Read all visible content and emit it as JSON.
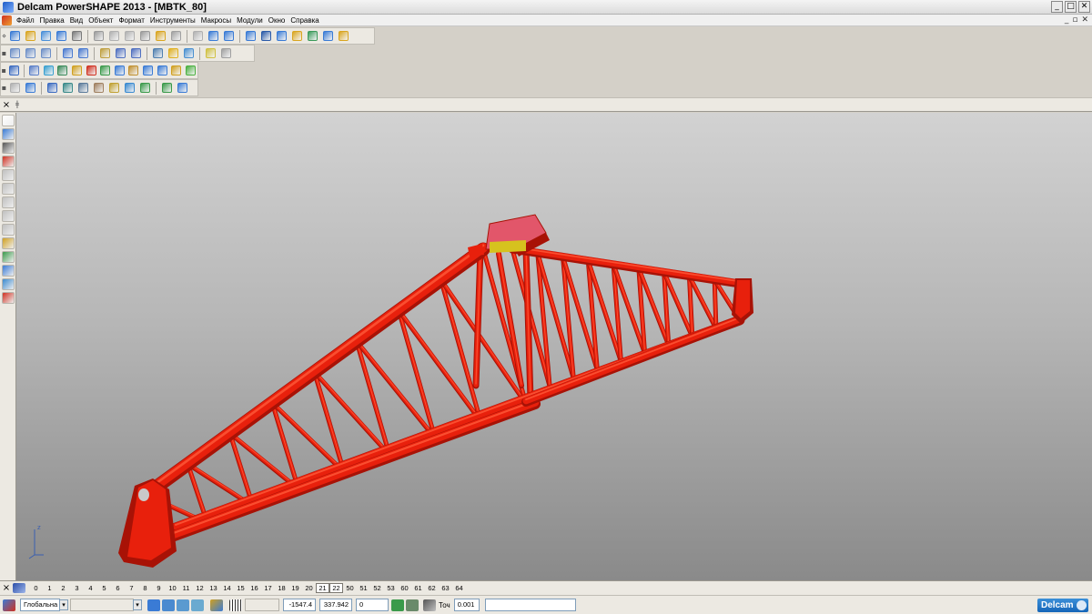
{
  "window": {
    "title": "Delcam PowerSHAPE 2013 - [MBTK_80]",
    "min": "_",
    "max": "□",
    "close": "✕"
  },
  "menu": {
    "items": [
      "Файл",
      "Правка",
      "Вид",
      "Объект",
      "Формат",
      "Инструменты",
      "Макросы",
      "Модули",
      "Окно",
      "Справка"
    ],
    "mdi_min": "_",
    "mdi_restore": "▫",
    "mdi_close": "✕"
  },
  "toolbars": {
    "row1_colors": [
      "#3a7bd5",
      "#d9a520",
      "#4a90d9",
      "#3a7bd5",
      "#7a7a7a",
      "#9a9a9a",
      "#b0b0b0",
      "#b0b0b0",
      "#9a9a9a",
      "#d9a520",
      "#a0a0a0",
      "#b0b0b0",
      "#3a7bd5",
      "#3a7bd5",
      "#3a7bd5",
      "#2a5aa8",
      "#3a7bd5",
      "#d9a520",
      "#3a9a5a",
      "#3a7bd5",
      "#d9a520"
    ],
    "row2_colors": [
      "#6d8fc7",
      "#6d8fc7",
      "#6d8fc7",
      "#4a7ad0",
      "#4a7ad0",
      "#c0a040",
      "#5070c0",
      "#5070c0",
      "#5080b0",
      "#e0b020",
      "#4a90d0",
      "#d0c040",
      "#a0a0a0"
    ],
    "row3_colors": [
      "#3a6ac0",
      "#5a7fc8",
      "#3aa0d0",
      "#3a8a5a",
      "#d0a020",
      "#d03020",
      "#3a9a4a",
      "#3a7bd5",
      "#c09030",
      "#3a7bd5",
      "#3a7bd5",
      "#d0a020",
      "#4ab040"
    ],
    "row4_colors": [
      "#b0b0b0",
      "#3a7bd5",
      "#3a6ac0",
      "#3a8a8a",
      "#5a7a9a",
      "#a08060",
      "#c0a030",
      "#3a8ad0",
      "#3a9a4a",
      "#3a9a4a",
      "#3a7bd5"
    ]
  },
  "lefttool_colors": [
    "#ffffff",
    "#3a7bd5",
    "#555555",
    "#d03020",
    "#c0c0c0",
    "#c0c0c0",
    "#c0c0c0",
    "#c0c0c0",
    "#c0c0c0",
    "#d0a020",
    "#3a9a4a",
    "#3a7bd5",
    "#3a8ad0",
    "#d03020"
  ],
  "levels": {
    "items": [
      "0",
      "1",
      "2",
      "3",
      "4",
      "5",
      "6",
      "7",
      "8",
      "9",
      "10",
      "11",
      "12",
      "13",
      "14",
      "15",
      "16",
      "17",
      "18",
      "19",
      "20",
      "21",
      "22",
      "50",
      "51",
      "52",
      "53",
      "60",
      "61",
      "62",
      "63",
      "64"
    ],
    "active": [
      "21",
      "22"
    ]
  },
  "status": {
    "workplane": "Глобальна",
    "x": "-1547.4",
    "y": "337.942",
    "z": "0",
    "tol_label": "Точ",
    "tol_value": "0.001",
    "brand": "Delcam"
  },
  "model": {
    "color": "#e8200c",
    "dark": "#a81206",
    "light": "#ff5a3a",
    "pad_color": "#e2566a",
    "yellow": "#d6c21e"
  }
}
